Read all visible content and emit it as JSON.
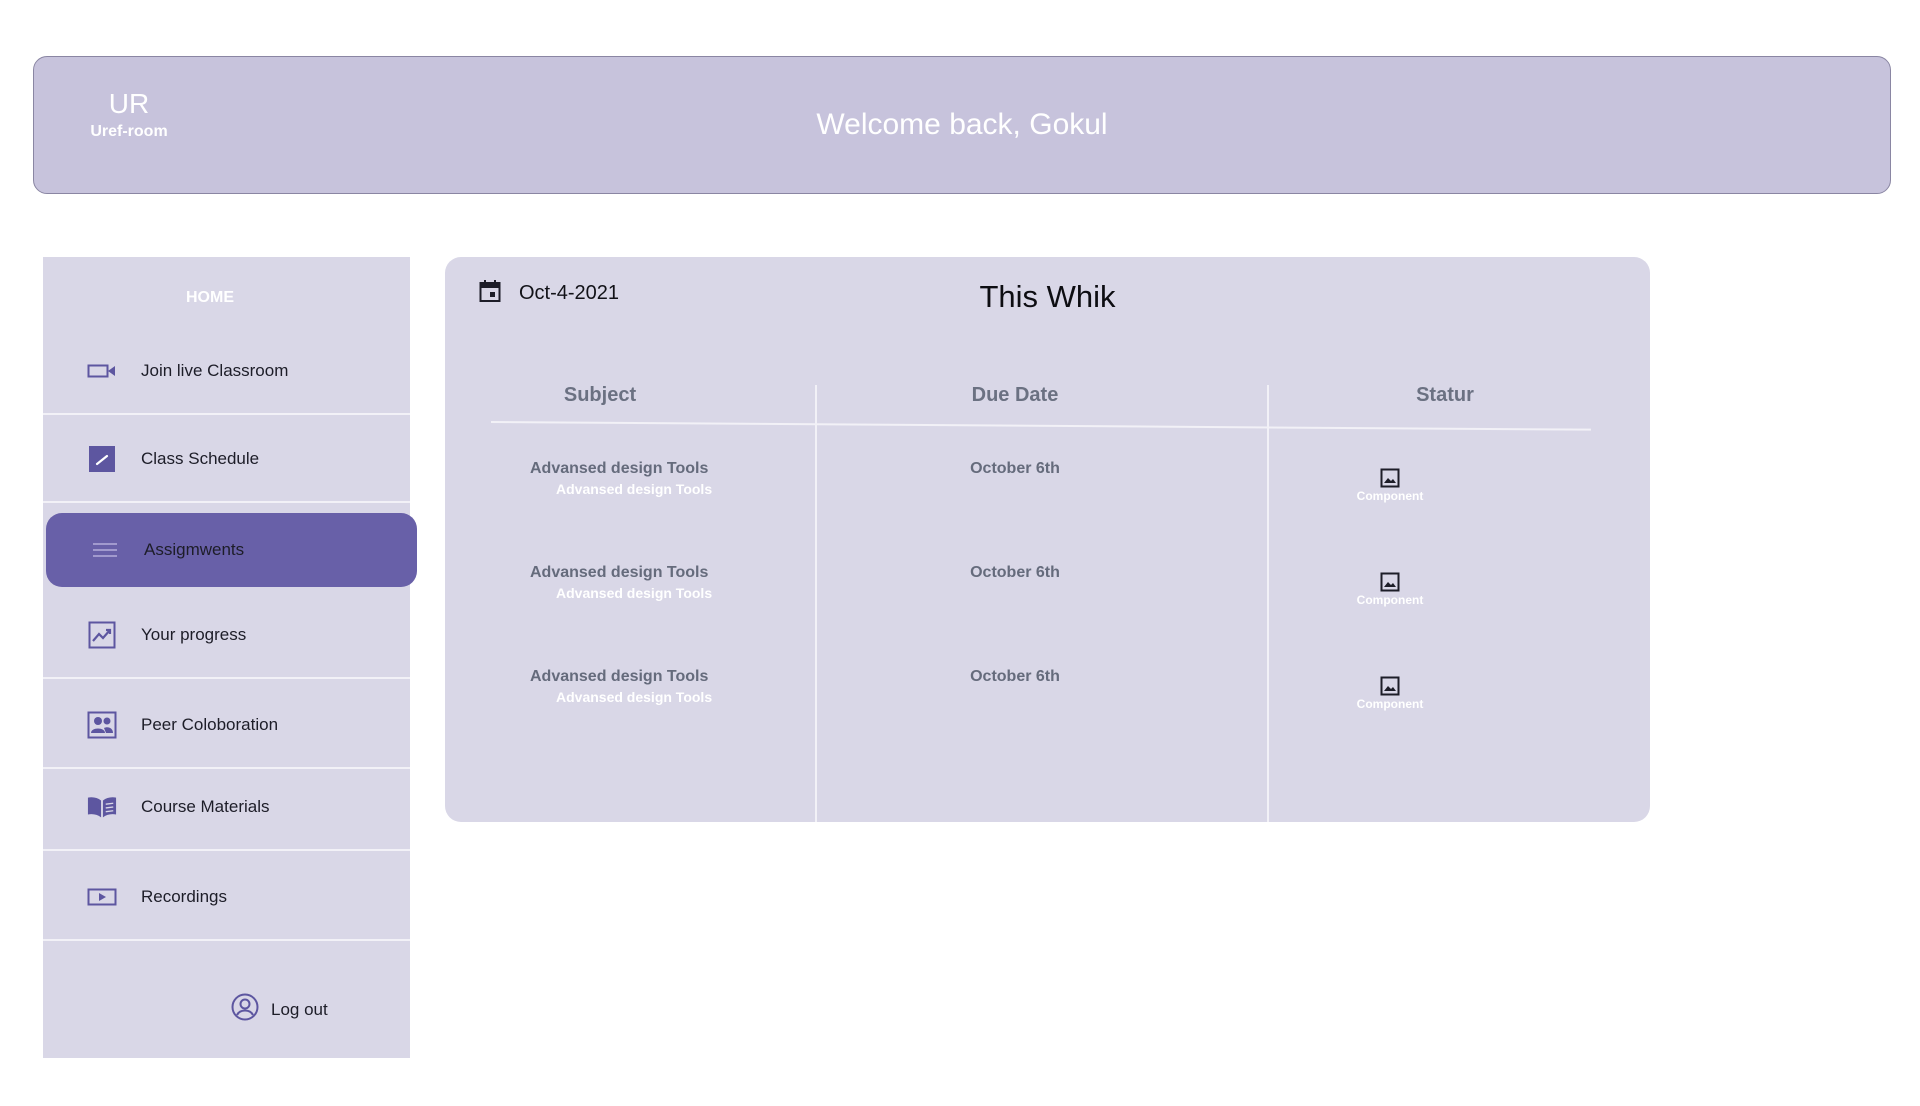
{
  "header": {
    "brand_mark": "UR",
    "brand_name": "Uref-room",
    "welcome": "Welcome back, Gokul"
  },
  "sidebar": {
    "home_label": "HOME",
    "items": [
      {
        "label": "Join live Classroom",
        "icon": "video-camera-icon"
      },
      {
        "label": "Class Schedule",
        "icon": "schedule-icon"
      },
      {
        "label": "Assigmwents",
        "icon": "list-icon",
        "active": true
      },
      {
        "label": "Your progress",
        "icon": "trending-chart-icon"
      },
      {
        "label": "Peer Coloboration",
        "icon": "people-icon"
      },
      {
        "label": "Course Materials",
        "icon": "book-icon"
      },
      {
        "label": "Recordings",
        "icon": "play-icon"
      }
    ],
    "logout_label": "Log out"
  },
  "panel": {
    "date": "Oct-4-2021",
    "title": "This Whik",
    "columns": [
      "Subject",
      "Due Date",
      "Statur"
    ],
    "rows": [
      {
        "subject": "Advansed design Tools",
        "subject_sub": "Advansed design Tools",
        "due": "October 6th",
        "status": "Component"
      },
      {
        "subject": "Advansed design Tools",
        "subject_sub": "Advansed design Tools",
        "due": "October 6th",
        "status": "Component"
      },
      {
        "subject": "Advansed design Tools",
        "subject_sub": "Advansed design Tools",
        "due": "October 6th",
        "status": "Component"
      }
    ]
  },
  "colors": {
    "header_bg": "#c7c3dc",
    "panel_bg": "#d9d7e7",
    "accent": "#6860a8",
    "icon": "#5d56a0"
  }
}
